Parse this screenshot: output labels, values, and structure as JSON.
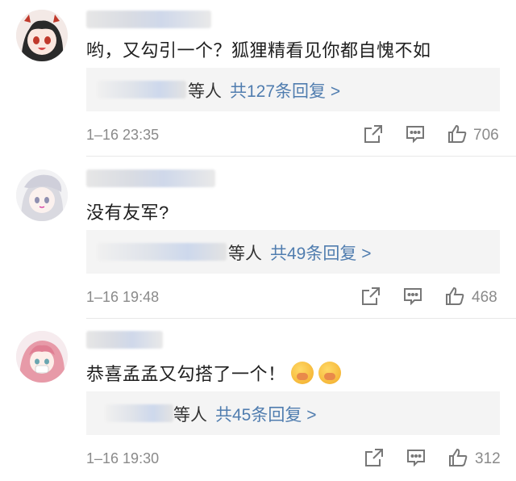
{
  "comments": [
    {
      "text": "哟，又勾引一个？狐狸精看见你都自愧不如",
      "reply_suffix": "等人",
      "reply_count": "共127条回复 >",
      "time": "1–16 23:35",
      "likes": "706"
    },
    {
      "text": "没有友军?",
      "reply_suffix": "等人",
      "reply_count": "共49条回复 >",
      "time": "1–16 19:48",
      "likes": "468"
    },
    {
      "text": "恭喜孟孟又勾搭了一个！",
      "reply_suffix": "等人",
      "reply_count": "共45条回复 >",
      "time": "1–16 19:30",
      "likes": "312"
    }
  ],
  "icons": {
    "share": "share-icon",
    "comment": "comment-icon",
    "like": "thumbs-up-icon",
    "emoji": "blushing-face-emoji"
  },
  "colors": {
    "link": "#507daf",
    "meta": "#8a8a8a",
    "reply_bg": "#f4f4f4"
  }
}
